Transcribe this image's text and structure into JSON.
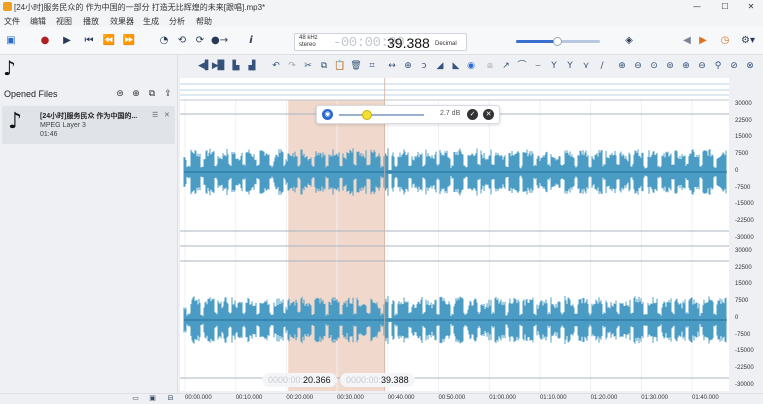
{
  "window": {
    "title": "[24小时]服务民众的 作为中国的一部分 打造无比辉煌的未来[跟唱].mp3*",
    "controls": [
      "minimize-icon",
      "maximize-icon",
      "close-icon"
    ]
  },
  "menu": [
    "文件",
    "编辑",
    "视图",
    "播放",
    "效果器",
    "生成",
    "分析",
    "帮助"
  ],
  "toolbar": {
    "format_line1": "48 kHz",
    "format_line2": "stereo",
    "time_dim": "-00:00:00:",
    "time_value": "39.388",
    "time_unit": "Decimal",
    "info_label": "i",
    "volume_percent": 45
  },
  "sidebar": {
    "panel_title": "Opened Files",
    "file": {
      "name": "[24小时]服务民众 作为中国的...",
      "type": "MPEG Layer 3",
      "duration": "01:46"
    }
  },
  "popup": {
    "gain_label": "2.7 dB",
    "slider_percent": 30
  },
  "selection": {
    "start_dim": "0000:00:",
    "start_value": "20.366",
    "end_dim": "0000:00:",
    "end_value": "39.388"
  },
  "yaxis": {
    "channel1": [
      "30000",
      "22500",
      "15000",
      "7500",
      "0",
      "-7500",
      "-15000",
      "-22500",
      "-30000"
    ],
    "channel2": [
      "30000",
      "22500",
      "15000",
      "7500",
      "0",
      "-7500",
      "-15000",
      "-22500",
      "-30000"
    ]
  },
  "xaxis": {
    "ticks": [
      "00:00.000",
      "00:10.000",
      "00:20.000",
      "00:30.000",
      "00:40.000",
      "00:50.000",
      "01:00.000",
      "01:10.000",
      "01:20.000",
      "01:30.000",
      "01:40.000"
    ]
  },
  "colors": {
    "waveform": "#4a9cc4",
    "selection": "#f0d8cc",
    "accent": "#3a6fd0"
  }
}
